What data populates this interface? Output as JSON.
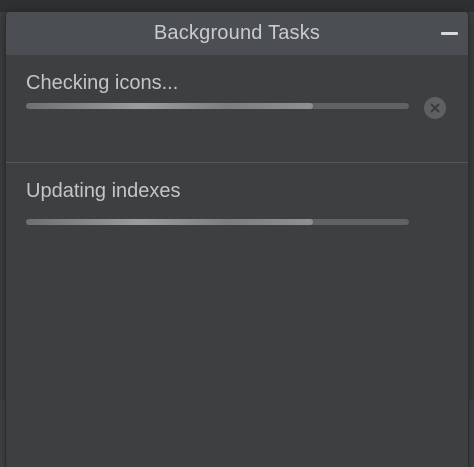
{
  "panel": {
    "title": "Background Tasks",
    "minimize_icon": "minus-icon"
  },
  "tasks": [
    {
      "label": "Checking icons...",
      "progress": 0.75,
      "cancel_icon": "close-circle-icon"
    },
    {
      "label": "Updating indexes",
      "progress": 0.75
    }
  ],
  "colors": {
    "panel_background": "#3d3f41",
    "header_background": "#4b4e52",
    "text": "#c3c5c7",
    "progress_fill": "#9a9c9e"
  }
}
